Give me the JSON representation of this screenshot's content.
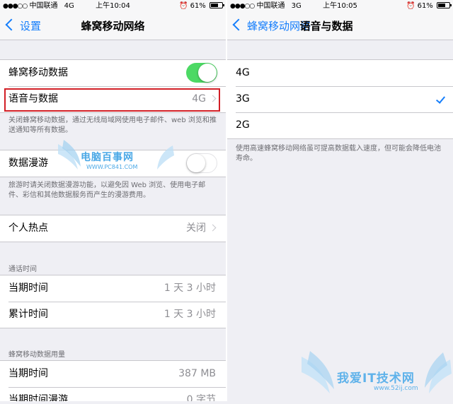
{
  "left_screen": {
    "status": {
      "carrier": "中国联通",
      "network": "4G",
      "time": "上午10:04",
      "battery": "61%"
    },
    "nav": {
      "back_label": "设置",
      "title": "蜂窝移动网络"
    },
    "cellular_data": {
      "label": "蜂窝移动数据",
      "enabled": true
    },
    "voice_data": {
      "label": "语音与数据",
      "value": "4G"
    },
    "cellular_footnote": "关闭蜂窝移动数据，通过无线局域网使用电子邮件、web 浏览和推送通知等所有数据。",
    "data_roaming": {
      "label": "数据漫游",
      "enabled": false
    },
    "roaming_footnote": "旅游时请关闭数据漫游功能，以避免因 Web 浏览、使用电子邮件、彩信和其他数据服务而产生的漫游费用。",
    "hotspot": {
      "label": "个人热点",
      "value": "关闭"
    },
    "call_time": {
      "header": "通话时间",
      "rows": [
        {
          "label": "当期时间",
          "value": "1 天 3 小时"
        },
        {
          "label": "累计时间",
          "value": "1 天 3 小时"
        }
      ]
    },
    "data_usage": {
      "header": "蜂窝移动数据用量",
      "rows": [
        {
          "label": "当期时间",
          "value": "387 MB"
        },
        {
          "label": "当期时间漫游",
          "value": "0 字节"
        }
      ]
    }
  },
  "right_screen": {
    "status": {
      "carrier": "中国联通",
      "network": "3G",
      "time": "上午10:05",
      "battery": "61%"
    },
    "nav": {
      "back_label": "蜂窝移动网络",
      "title": "语音与数据"
    },
    "options": [
      {
        "label": "4G",
        "selected": false
      },
      {
        "label": "3G",
        "selected": true
      },
      {
        "label": "2G",
        "selected": false
      }
    ],
    "footnote": "使用高速蜂窝移动网络虽可提高数据载入速度，但可能会降低电池寿命。"
  },
  "watermarks": {
    "left": {
      "title": "电脑百事网",
      "url": "WWW.PC841.COM"
    },
    "right": {
      "title": "我爱IT技术网",
      "url": "www.52ij.com"
    }
  },
  "colors": {
    "accent": "#157efb",
    "toggle_on": "#4cd964",
    "highlight": "#d21f26",
    "background": "#efeff4"
  },
  "icons": [
    "signal-dots-icon",
    "alarm-icon",
    "battery-icon",
    "chevron-left-icon",
    "chevron-right-icon",
    "checkmark-icon"
  ]
}
